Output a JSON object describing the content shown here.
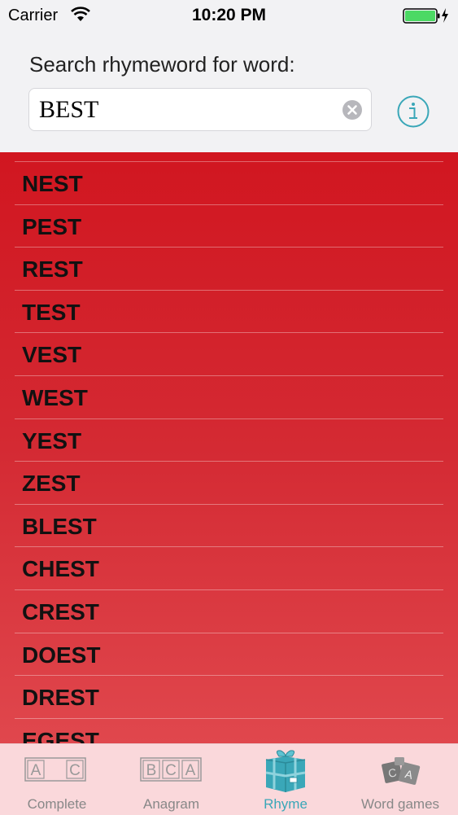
{
  "status_bar": {
    "carrier": "Carrier",
    "time": "10:20 PM",
    "battery_color": "#4cd964"
  },
  "search": {
    "label": "Search rhymeword for word:",
    "value": "BEST",
    "clear_icon": "clear-circle-icon",
    "info_icon": "info-circle-icon"
  },
  "results": [
    "NEST",
    "PEST",
    "REST",
    "TEST",
    "VEST",
    "WEST",
    "YEST",
    "ZEST",
    "BLEST",
    "CHEST",
    "CREST",
    "DOEST",
    "DREST",
    "EGEST"
  ],
  "tab_bar": {
    "active_color": "#3aa7b8",
    "tabs": [
      {
        "label": "Complete",
        "icon": "letter-tiles-ac-icon",
        "active": false
      },
      {
        "label": "Anagram",
        "icon": "letter-tiles-bca-icon",
        "active": false
      },
      {
        "label": "Rhyme",
        "icon": "gift-box-icon",
        "active": true
      },
      {
        "label": "Word games",
        "icon": "game-cards-icon",
        "active": false
      }
    ]
  },
  "colors": {
    "list_gradient_top": "#d11620",
    "list_gradient_bottom": "#e0474d",
    "header_bg": "#f2f2f4"
  }
}
